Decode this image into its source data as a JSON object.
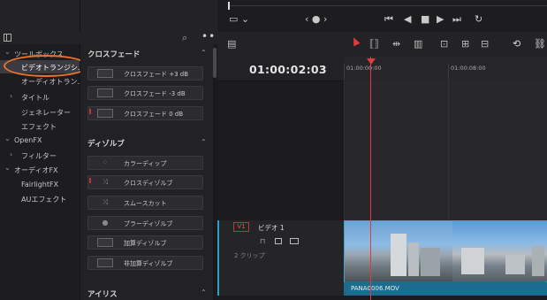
{
  "sidebar": {
    "tree": [
      {
        "label": "ツールボックス",
        "arrow": "⌄"
      },
      {
        "label": "ビデオトランジシ...",
        "selected": true
      },
      {
        "label": "オーディオトラン..."
      },
      {
        "label": "タイトル",
        "arrow": "›"
      },
      {
        "label": "ジェネレーター"
      },
      {
        "label": "エフェクト"
      },
      {
        "label": "OpenFX",
        "arrow": "⌄"
      },
      {
        "label": "フィルター",
        "arrow": "›"
      },
      {
        "label": "オーディオFX",
        "arrow": "⌄"
      },
      {
        "label": "FairlightFX"
      },
      {
        "label": "AUエフェクト"
      }
    ]
  },
  "effects": {
    "sections": [
      {
        "title": "クロスフェード",
        "items": [
          {
            "label": "クロスフェード +3 dB"
          },
          {
            "label": "クロスフェード -3 dB"
          },
          {
            "label": "クロスフェード 0 dB",
            "marked": true
          }
        ]
      },
      {
        "title": "ディゾルブ",
        "items": [
          {
            "label": "カラーディップ"
          },
          {
            "label": "クロスディゾルブ",
            "marked": true
          },
          {
            "label": "スムースカット"
          },
          {
            "label": "ブラーディゾルブ"
          },
          {
            "label": "加算ディゾルブ"
          },
          {
            "label": "非加算ディゾルブ"
          }
        ]
      },
      {
        "title": "アイリス",
        "items": []
      }
    ]
  },
  "viewer": {
    "nav_label": "‹ ● ›"
  },
  "timeline": {
    "timecode": "01:00:02:03",
    "ruler": [
      "01:00:00:00",
      "01:00:08:00"
    ],
    "track": {
      "badge": "V1",
      "name": "ビデオ 1",
      "clip_count": "2 クリップ"
    },
    "clip_name": "PANA0006.MOV"
  },
  "colors": {
    "accent_red": "#e23b3b",
    "clip_blue": "#1f6f8f",
    "highlight_orange": "#e8742a"
  }
}
